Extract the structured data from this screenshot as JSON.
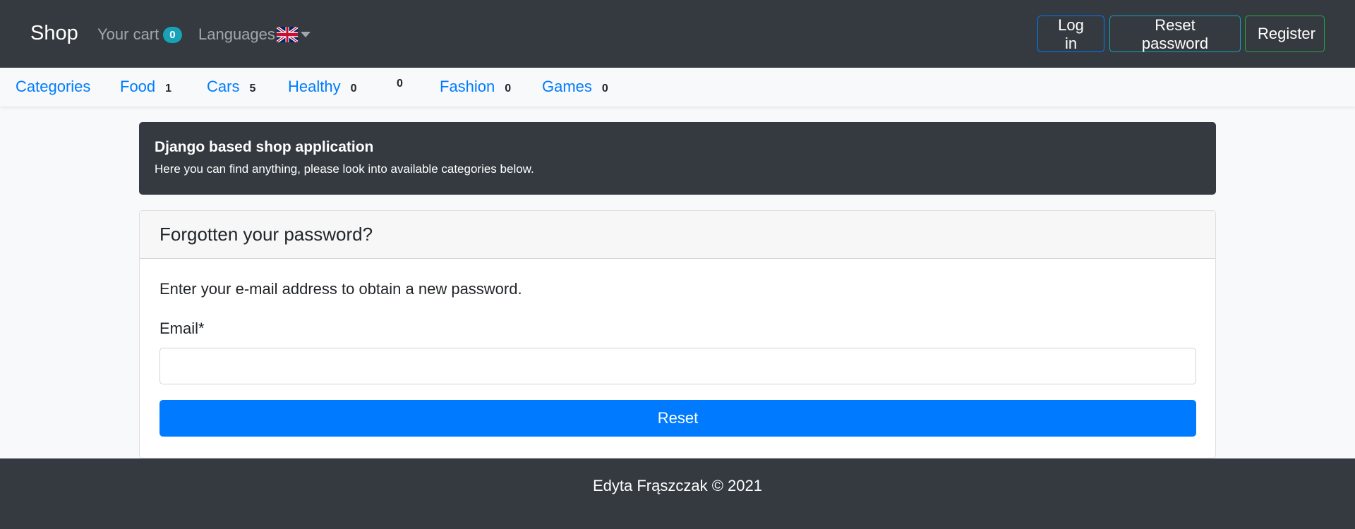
{
  "navbar": {
    "brand": "Shop",
    "cart_label": "Your cart",
    "cart_count": "0",
    "languages_label": "Languages",
    "flag_icon": "uk-flag-icon",
    "buttons": {
      "login": "Log in",
      "reset_password": "Reset password",
      "register": "Register"
    }
  },
  "categories": {
    "label": "Categories",
    "items": [
      {
        "name": "Food",
        "count": "1"
      },
      {
        "name": "Cars",
        "count": "5"
      },
      {
        "name": "Healthy",
        "count": "0"
      },
      {
        "name": "",
        "count": "0"
      },
      {
        "name": "Fashion",
        "count": "0"
      },
      {
        "name": "Games",
        "count": "0"
      }
    ]
  },
  "jumbotron": {
    "title": "Django based shop application",
    "subtitle": "Here you can find anything, please look into available categories below."
  },
  "form": {
    "heading": "Forgotten your password?",
    "instructions": "Enter your e-mail address to obtain a new password.",
    "email_label": "Email*",
    "email_value": "",
    "submit_label": "Reset"
  },
  "footer": {
    "text": "Edyta Frąszczak © 2021"
  },
  "colors": {
    "navbar_bg": "#343a40",
    "primary": "#007bff",
    "info": "#17a2b8",
    "success": "#28a745"
  }
}
